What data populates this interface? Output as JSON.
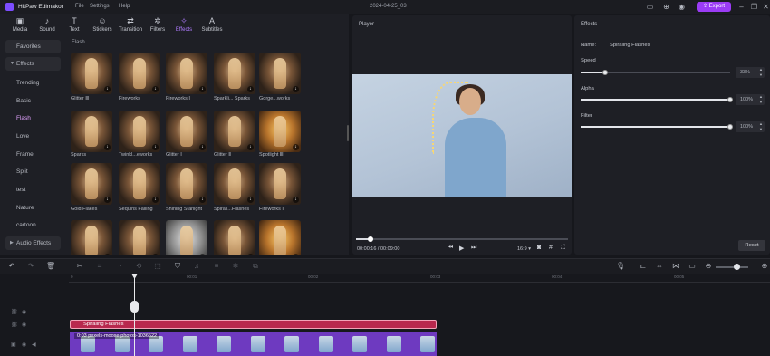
{
  "app": {
    "name": "HitPaw Edimakor",
    "project_title": "2024-04-25_03"
  },
  "menu": [
    "File",
    "Settings",
    "Help"
  ],
  "titlebar": {
    "export_label": "Export"
  },
  "toolbar": [
    {
      "label": "Media",
      "icon": "media-icon"
    },
    {
      "label": "Sound",
      "icon": "sound-icon"
    },
    {
      "label": "Text",
      "icon": "text-icon"
    },
    {
      "label": "Stickers",
      "icon": "stickers-icon"
    },
    {
      "label": "Transition",
      "icon": "transition-icon"
    },
    {
      "label": "Filters",
      "icon": "filters-icon"
    },
    {
      "label": "Effects",
      "icon": "effects-icon",
      "active": true
    },
    {
      "label": "Subtitles",
      "icon": "subtitles-icon"
    }
  ],
  "leftnav": {
    "favorites": "Favorites",
    "effects_group": "Effects",
    "items": [
      "Trending",
      "Basic",
      "Flash",
      "Love",
      "Frame",
      "Split",
      "test",
      "Nature",
      "cartoon"
    ],
    "active": "Flash",
    "audio_group": "Audio Effects"
  },
  "assets": {
    "section_label": "Flash",
    "items": [
      {
        "label": "Glitter Ⅲ"
      },
      {
        "label": "Fireworks"
      },
      {
        "label": "Fireworks Ⅰ"
      },
      {
        "label": "Sparkli... Sparks"
      },
      {
        "label": "Gorge...works"
      },
      {
        "label": "Sparks"
      },
      {
        "label": "Twinkl...eworks"
      },
      {
        "label": "Glitter Ⅰ"
      },
      {
        "label": "Glitter Ⅱ"
      },
      {
        "label": "Spotlight Ⅲ"
      },
      {
        "label": "Gold Flakes"
      },
      {
        "label": "Sequins Falling"
      },
      {
        "label": "Shining Starlight"
      },
      {
        "label": "Spirali...Flashes"
      },
      {
        "label": "Fireworks Ⅱ"
      },
      {
        "label": ""
      },
      {
        "label": ""
      },
      {
        "label": ""
      },
      {
        "label": ""
      },
      {
        "label": ""
      }
    ]
  },
  "player": {
    "title": "Player",
    "current_time": "00:00:16 / 00:09:00",
    "aspect_ratio": "16:9 ▾",
    "progress_fraction": 0.07
  },
  "props": {
    "title": "Effects",
    "name_label": "Name:",
    "name_value": "Spiraling Flashes",
    "speed_label": "Speed",
    "speed_value": "33%",
    "speed_fraction": 0.33,
    "alpha_label": "Alpha",
    "alpha_value": "100%",
    "alpha_fraction": 1.0,
    "filter_label": "Filter",
    "filter_value": "100%",
    "filter_fraction": 1.0,
    "reset_label": "Reset"
  },
  "timeline": {
    "ruler_ticks": [
      "0",
      "00:01",
      "00:02",
      "00:03",
      "00:04",
      "00:05"
    ],
    "effect_clip_label": "Spiraling Flashes",
    "video_clip_label": "0:03 pexels-moose-photos-1036622",
    "zoom_fraction": 0.55
  },
  "colors": {
    "accent": "#9b3cf5",
    "effect_clip": "#b8284e",
    "video_clip": "#6e3ac0"
  }
}
